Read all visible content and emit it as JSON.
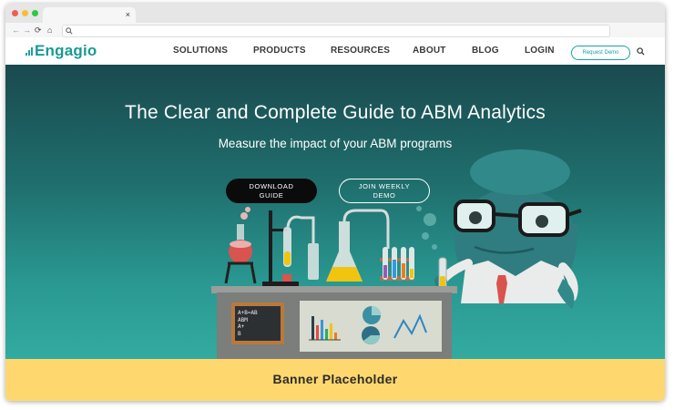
{
  "browser": {
    "tab_close": "×",
    "controls": {
      "back": "←",
      "forward": "→",
      "reload": "⟳",
      "home": "⌂"
    },
    "search_icon": "search-icon",
    "colors": {
      "close": "#ee5d55",
      "minimize": "#f6bd35",
      "maximize": "#2dc941"
    }
  },
  "site": {
    "logo": {
      "text": "Engagio",
      "color": "#1a9a94"
    },
    "nav": [
      "SOLUTIONS",
      "PRODUCTS",
      "RESOURCES",
      "ABOUT",
      "BLOG",
      "LOGIN"
    ],
    "request_demo": "Request Demo",
    "accent": "#19a39b"
  },
  "hero": {
    "title": "The Clear and Complete Guide to ABM Analytics",
    "subtitle": "Measure the impact of your ABM programs",
    "download_line1": "DOWNLOAD",
    "download_line2": "GUIDE",
    "demo_line1": "JOIN WEEKLY",
    "demo_line2": "DEMO",
    "chalkboard_lines": [
      "A+B=AB",
      "ABM",
      "A+",
      "B"
    ]
  },
  "banner": {
    "text": "Banner Placeholder",
    "color": "#fed86e"
  }
}
